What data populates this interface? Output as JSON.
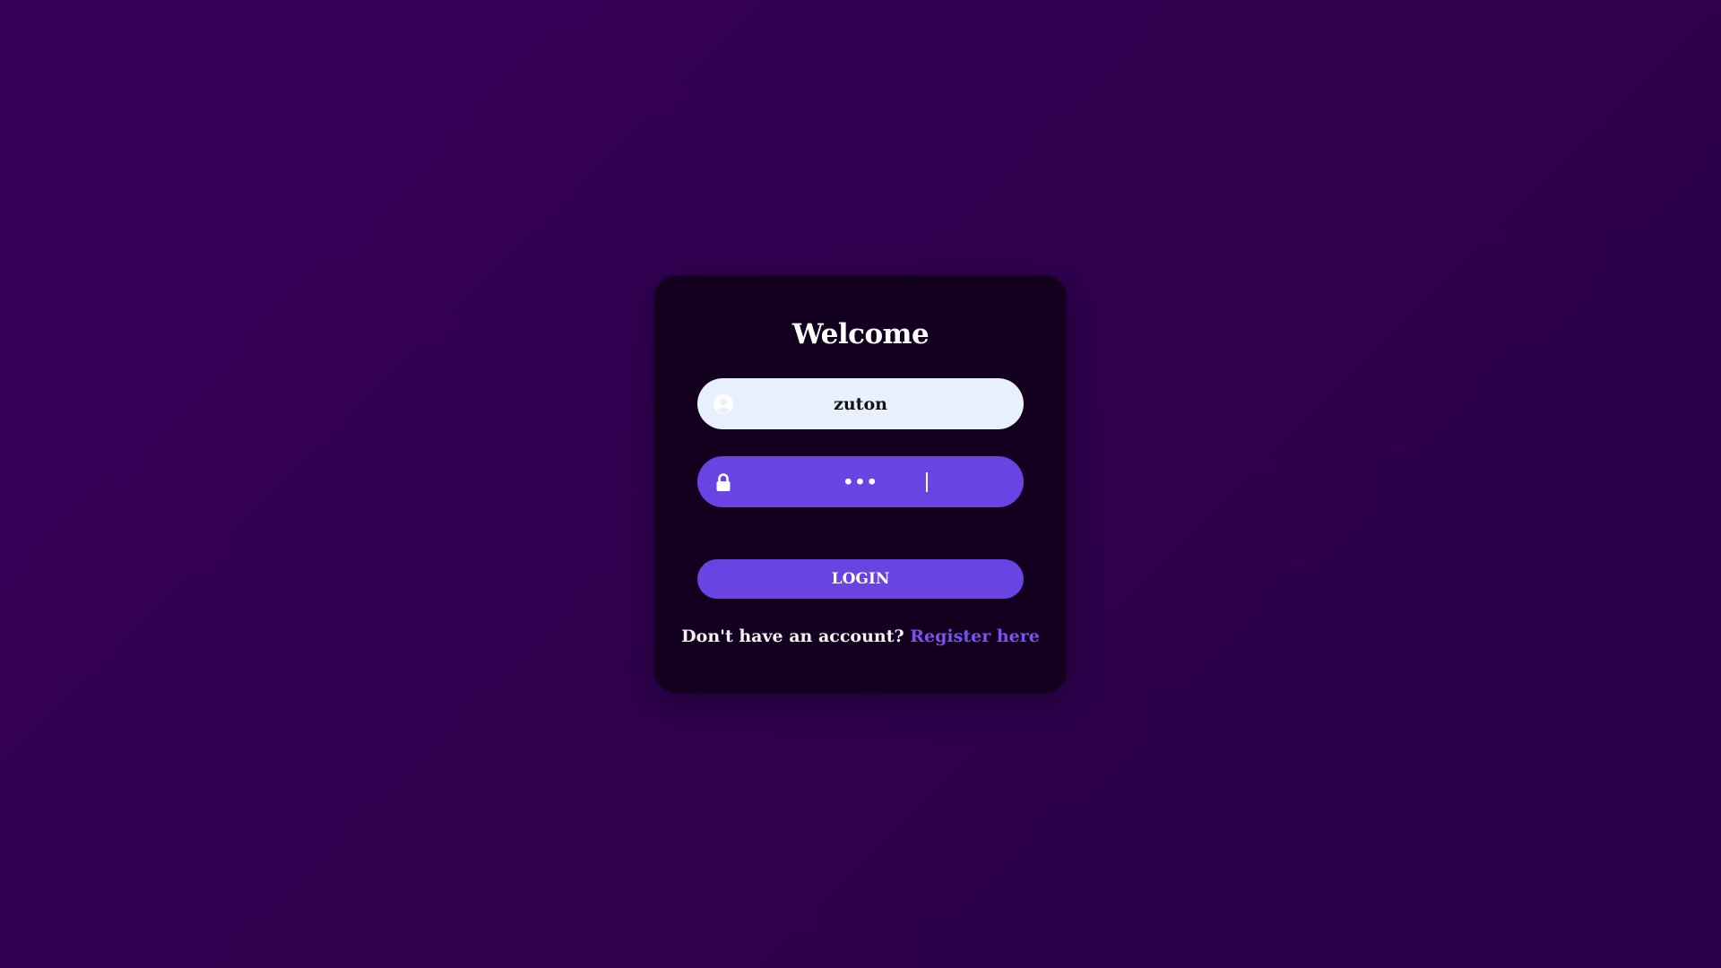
{
  "login_card": {
    "title": "Welcome",
    "username": {
      "value": "zuton",
      "icon": "user-circle-icon"
    },
    "password": {
      "value": "•••",
      "icon": "lock-icon"
    },
    "login_label": "LOGIN",
    "footer_text": "Don't have an account?",
    "register_link": "Register here"
  },
  "colors": {
    "background": "#33004f",
    "card": "#13001f",
    "accent": "#6a43e3",
    "username_field": "#e8f0fe",
    "link": "#7b52f0"
  }
}
